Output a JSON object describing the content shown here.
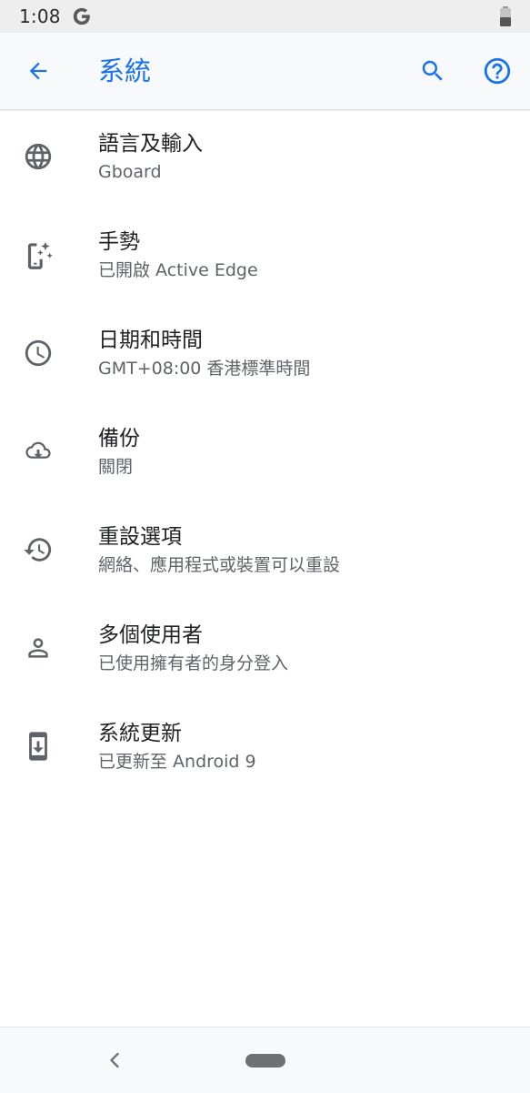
{
  "status_bar": {
    "time": "1:08"
  },
  "app_bar": {
    "title": "系統",
    "accent_color": "#1a73e8"
  },
  "items": [
    {
      "icon": "globe-icon",
      "title": "語言及輸入",
      "subtitle": "Gboard"
    },
    {
      "icon": "gestures-icon",
      "title": "手勢",
      "subtitle": "已開啟 Active Edge"
    },
    {
      "icon": "clock-icon",
      "title": "日期和時間",
      "subtitle": "GMT+08:00 香港標準時間"
    },
    {
      "icon": "backup-cloud-icon",
      "title": "備份",
      "subtitle": "關閉"
    },
    {
      "icon": "reset-history-icon",
      "title": "重設選項",
      "subtitle": "網絡、應用程式或裝置可以重設"
    },
    {
      "icon": "person-icon",
      "title": "多個使用者",
      "subtitle": "已使用擁有者的身分登入"
    },
    {
      "icon": "system-update-icon",
      "title": "系統更新",
      "subtitle": "已更新至 Android 9"
    }
  ]
}
